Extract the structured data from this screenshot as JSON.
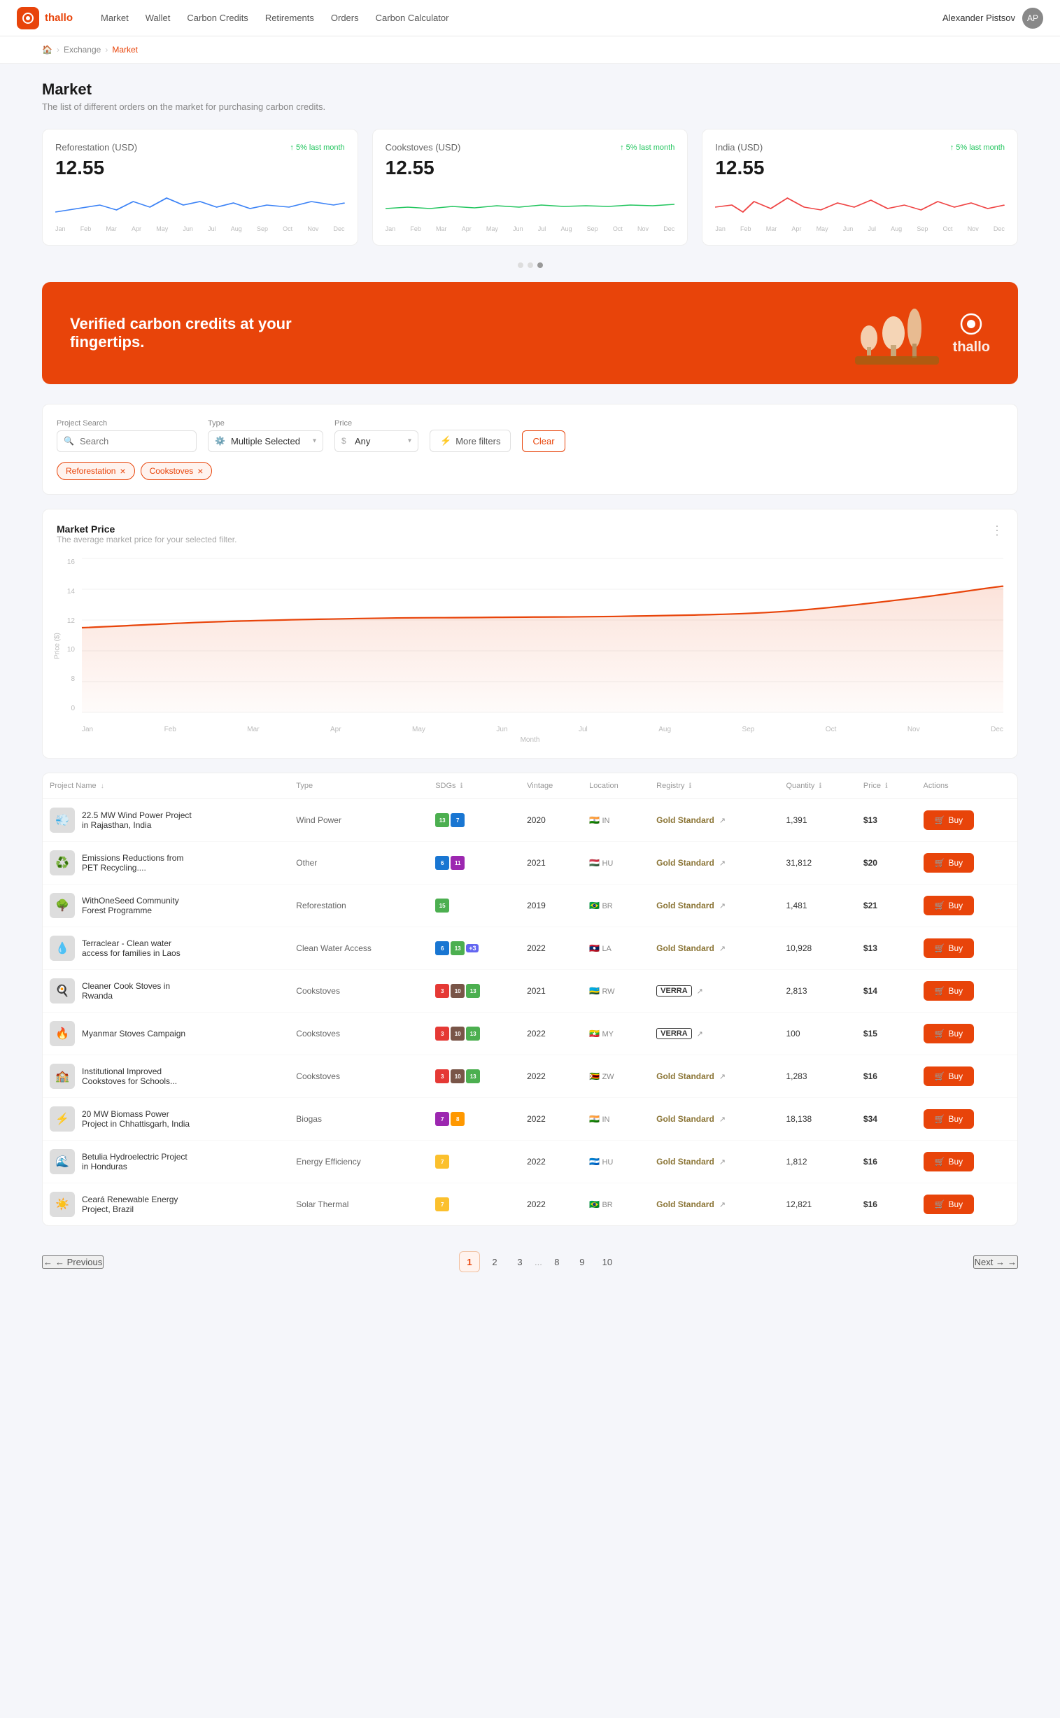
{
  "app": {
    "logo": "⊕",
    "name": "thallo"
  },
  "nav": {
    "links": [
      {
        "label": "Market",
        "active": false
      },
      {
        "label": "Wallet",
        "active": false
      },
      {
        "label": "Carbon Credits",
        "active": false
      },
      {
        "label": "Retirements",
        "active": false
      },
      {
        "label": "Orders",
        "active": false
      },
      {
        "label": "Carbon Calculator",
        "active": false
      }
    ],
    "user": "Alexander Pistsov"
  },
  "breadcrumb": {
    "home": "🏠",
    "exchange": "Exchange",
    "current": "Market"
  },
  "page": {
    "title": "Market",
    "subtitle": "The list of different orders on the market for purchasing carbon credits."
  },
  "price_cards": [
    {
      "title": "Reforestation (USD)",
      "badge": "↑ 5% last month",
      "value": "12.55",
      "color": "#3b82f6",
      "months": [
        "Jan",
        "Feb",
        "Mar",
        "Apr",
        "May",
        "Jun",
        "Jul",
        "Aug",
        "Sep",
        "Oct",
        "Nov",
        "Dec"
      ]
    },
    {
      "title": "Cookstoves (USD)",
      "badge": "↑ 5% last month",
      "value": "12.55",
      "color": "#22c55e",
      "months": [
        "Jan",
        "Feb",
        "Mar",
        "Apr",
        "May",
        "Jun",
        "Jul",
        "Aug",
        "Sep",
        "Oct",
        "Nov",
        "Dec"
      ]
    },
    {
      "title": "India (USD)",
      "badge": "↑ 5% last month",
      "value": "12.55",
      "color": "#ef4444",
      "months": [
        "Jan",
        "Feb",
        "Mar",
        "Apr",
        "May",
        "Jun",
        "Jul",
        "Aug",
        "Sep",
        "Oct",
        "Nov",
        "Dec"
      ]
    }
  ],
  "banner": {
    "text": "Verified carbon credits at your fingertips.",
    "logo": "thallo"
  },
  "filters": {
    "search_label": "Project Search",
    "search_placeholder": "Search",
    "type_label": "Type",
    "type_value": "Multiple Selected",
    "price_label": "Price",
    "price_value": "Any",
    "more_filters": "More filters",
    "clear": "Clear",
    "tags": [
      "Reforestation",
      "Cookstoves"
    ]
  },
  "chart": {
    "title": "Market Price",
    "subtitle": "The average market price for your selected filter.",
    "y_labels": [
      "16",
      "14",
      "12",
      "10",
      "8",
      "0"
    ],
    "x_labels": [
      "Jan",
      "Feb",
      "Mar",
      "Apr",
      "May",
      "Jun",
      "Jul",
      "Aug",
      "Sep",
      "Oct",
      "Nov",
      "Dec"
    ],
    "y_axis_title": "Price ($)",
    "x_axis_title": "Month"
  },
  "table": {
    "columns": [
      {
        "label": "Project Name",
        "sort": true,
        "info": false
      },
      {
        "label": "Type",
        "sort": false,
        "info": false
      },
      {
        "label": "SDGs",
        "sort": false,
        "info": true
      },
      {
        "label": "Vintage",
        "sort": false,
        "info": false
      },
      {
        "label": "Location",
        "sort": false,
        "info": false
      },
      {
        "label": "Registry",
        "sort": false,
        "info": true
      },
      {
        "label": "Quantity",
        "sort": false,
        "info": true
      },
      {
        "label": "Price",
        "sort": false,
        "info": true
      },
      {
        "label": "Actions",
        "sort": false,
        "info": false
      }
    ],
    "rows": [
      {
        "name": "22.5 MW Wind Power Project in Rajasthan, India",
        "type": "Wind Power",
        "sdgs": [
          {
            "color": "#4caf50",
            "label": "13"
          },
          {
            "color": "#1976d2",
            "label": "7"
          }
        ],
        "vintage": "2020",
        "flag": "🇮🇳",
        "country": "IN",
        "registry": "Gold Standard",
        "registry_type": "gold",
        "quantity": "1,391",
        "price": "$13",
        "thumb": "💨"
      },
      {
        "name": "Emissions Reductions from PET Recycling....",
        "type": "Other",
        "sdgs": [
          {
            "color": "#1976d2",
            "label": "6"
          },
          {
            "color": "#9c27b0",
            "label": "11"
          }
        ],
        "vintage": "2021",
        "flag": "🇭🇺",
        "country": "HU",
        "registry": "Gold Standard",
        "registry_type": "gold",
        "quantity": "31,812",
        "price": "$20",
        "thumb": "♻️"
      },
      {
        "name": "WithOneSeed Community Forest Programme",
        "type": "Reforestation",
        "sdgs": [
          {
            "color": "#4caf50",
            "label": "15"
          }
        ],
        "vintage": "2019",
        "flag": "🇧🇷",
        "country": "BR",
        "registry": "Gold Standard",
        "registry_type": "gold",
        "quantity": "1,481",
        "price": "$21",
        "thumb": "🌳"
      },
      {
        "name": "Terraclear - Clean water access for families in Laos",
        "type": "Clean Water Access",
        "sdgs": [
          {
            "color": "#1976d2",
            "label": "6"
          },
          {
            "color": "#4caf50",
            "label": "13"
          },
          {
            "label": "+3",
            "color": "#6366f1",
            "plus": true
          }
        ],
        "vintage": "2022",
        "flag": "🇱🇦",
        "country": "LA",
        "registry": "Gold Standard",
        "registry_type": "gold",
        "quantity": "10,928",
        "price": "$13",
        "thumb": "💧"
      },
      {
        "name": "Cleaner Cook Stoves in Rwanda",
        "type": "Cookstoves",
        "sdgs": [
          {
            "color": "#e53935",
            "label": "3"
          },
          {
            "color": "#795548",
            "label": "10"
          },
          {
            "color": "#4caf50",
            "label": "13"
          }
        ],
        "vintage": "2021",
        "flag": "🇷🇼",
        "country": "RW",
        "registry": "Verra",
        "registry_type": "verra",
        "quantity": "2,813",
        "price": "$14",
        "thumb": "🍳"
      },
      {
        "name": "Myanmar Stoves Campaign",
        "type": "Cookstoves",
        "sdgs": [
          {
            "color": "#e53935",
            "label": "3"
          },
          {
            "color": "#795548",
            "label": "10"
          },
          {
            "color": "#4caf50",
            "label": "13"
          }
        ],
        "vintage": "2022",
        "flag": "🇲🇲",
        "country": "MY",
        "registry": "Verra",
        "registry_type": "verra",
        "quantity": "100",
        "price": "$15",
        "thumb": "🔥"
      },
      {
        "name": "Institutional Improved Cookstoves for Schools...",
        "type": "Cookstoves",
        "sdgs": [
          {
            "color": "#e53935",
            "label": "3"
          },
          {
            "color": "#795548",
            "label": "10"
          },
          {
            "color": "#4caf50",
            "label": "13"
          }
        ],
        "vintage": "2022",
        "flag": "🇿🇼",
        "country": "ZW",
        "registry": "Gold Standard",
        "registry_type": "gold",
        "quantity": "1,283",
        "price": "$16",
        "thumb": "🏫"
      },
      {
        "name": "20 MW Biomass Power Project in Chhattisgarh, India",
        "type": "Biogas",
        "sdgs": [
          {
            "color": "#9c27b0",
            "label": "7"
          },
          {
            "color": "#ff9800",
            "label": "8"
          }
        ],
        "vintage": "2022",
        "flag": "🇮🇳",
        "country": "IN",
        "registry": "Gold Standard",
        "registry_type": "gold",
        "quantity": "18,138",
        "price": "$34",
        "thumb": "⚡"
      },
      {
        "name": "Betulia Hydroelectric Project in Honduras",
        "type": "Energy Efficiency",
        "sdgs": [
          {
            "color": "#fbc02d",
            "label": "7"
          }
        ],
        "vintage": "2022",
        "flag": "🇭🇳",
        "country": "HU",
        "registry": "Gold Standard",
        "registry_type": "gold",
        "quantity": "1,812",
        "price": "$16",
        "thumb": "🌊"
      },
      {
        "name": "Ceará Renewable Energy Project, Brazil",
        "type": "Solar Thermal",
        "sdgs": [
          {
            "color": "#fbc02d",
            "label": "7"
          }
        ],
        "vintage": "2022",
        "flag": "🇧🇷",
        "country": "BR",
        "registry": "Gold Standard",
        "registry_type": "gold",
        "quantity": "12,821",
        "price": "$16",
        "thumb": "☀️"
      }
    ]
  },
  "pagination": {
    "prev": "← Previous",
    "next": "Next →",
    "pages": [
      "1",
      "2",
      "3",
      "...",
      "8",
      "9",
      "10"
    ],
    "active": "1"
  }
}
